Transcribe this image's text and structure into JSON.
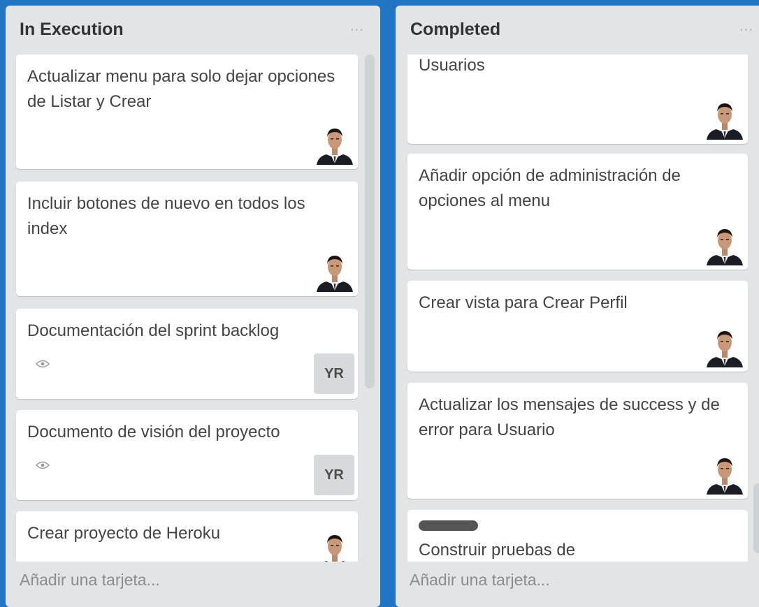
{
  "lists": [
    {
      "title": "In Execution",
      "menu_icon": "ellipsis-icon",
      "add_card": "Añadir una tarjeta...",
      "cards": [
        {
          "title": "Actualizar menu para solo dejar opciones de Listar y Crear",
          "member": "avatar-photo"
        },
        {
          "title": "Incluir botones de nuevo en todos los index",
          "member": "avatar-photo"
        },
        {
          "title": "Documentación del sprint backlog",
          "badge": "eye-icon",
          "member_initials": "YR"
        },
        {
          "title": "Documento de visión del proyecto",
          "badge": "eye-icon",
          "member_initials": "YR"
        },
        {
          "title": "Crear proyecto de Heroku",
          "member": "avatar-photo"
        }
      ]
    },
    {
      "title": "Completed",
      "menu_icon": "ellipsis-icon",
      "add_card": "Añadir una tarjeta...",
      "cards": [
        {
          "title": "Usuarios",
          "member": "avatar-photo"
        },
        {
          "title": "Añadir opción de administración de opciones al menu",
          "member": "avatar-photo"
        },
        {
          "title": "Crear vista para Crear Perfil",
          "member": "avatar-photo"
        },
        {
          "title": "Actualizar los mensajes de success y de error para Usuario",
          "member": "avatar-photo"
        },
        {
          "title": "Construir pruebas de",
          "label_color": "#555555"
        }
      ]
    }
  ],
  "colors": {
    "board_background": "#1f74c4",
    "list_background": "#e2e4e6",
    "card_background": "#ffffff"
  }
}
